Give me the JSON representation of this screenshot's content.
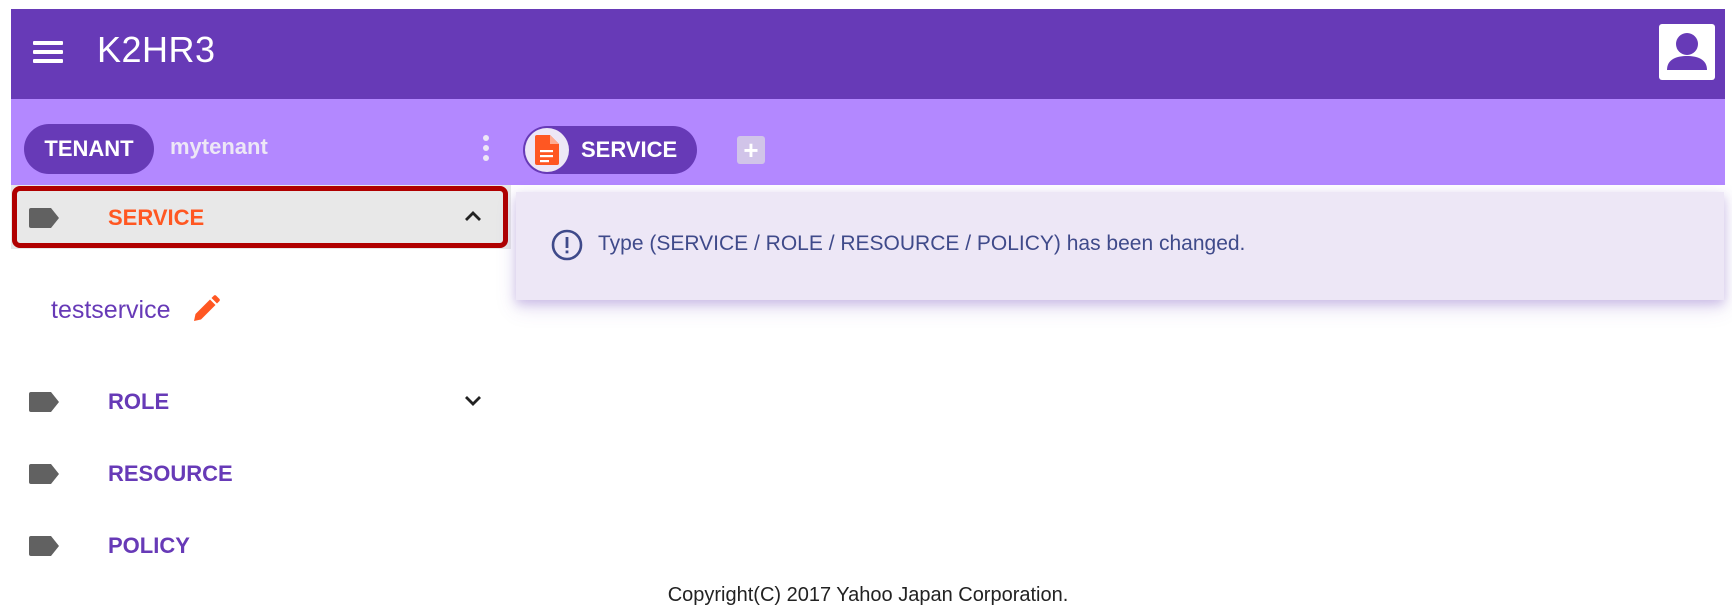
{
  "appbar": {
    "title": "K2HR3",
    "menu_icon": "menu-icon",
    "account_icon": "account-icon"
  },
  "toolbar": {
    "tenant_chip_label": "TENANT",
    "tenant_name": "mytenant",
    "more_icon": "more-vert-icon",
    "type_chip_label": "SERVICE",
    "type_chip_icon": "document-icon",
    "add_icon": "add-box-icon"
  },
  "sidebar": {
    "items": [
      {
        "label": "SERVICE",
        "expanded": true,
        "selected": true,
        "icon": "label-icon",
        "chevron": "chevron-up-icon"
      },
      {
        "label": "ROLE",
        "expanded": false,
        "selected": false,
        "icon": "label-icon",
        "chevron": "chevron-down-icon"
      },
      {
        "label": "RESOURCE",
        "icon": "label-icon"
      },
      {
        "label": "POLICY",
        "icon": "label-icon"
      }
    ],
    "service_children": [
      {
        "label": "testservice",
        "action_icon": "edit-icon"
      }
    ]
  },
  "message": {
    "icon": "info-icon",
    "text": "Type (SERVICE / ROLE / RESOURCE / POLICY) has been changed."
  },
  "footer": {
    "copyright": "Copyright(C) 2017 Yahoo Japan Corporation."
  },
  "colors": {
    "primary": "#673ab7",
    "light": "#b388ff",
    "accent": "#ff5722",
    "highlight": "#b00000"
  }
}
